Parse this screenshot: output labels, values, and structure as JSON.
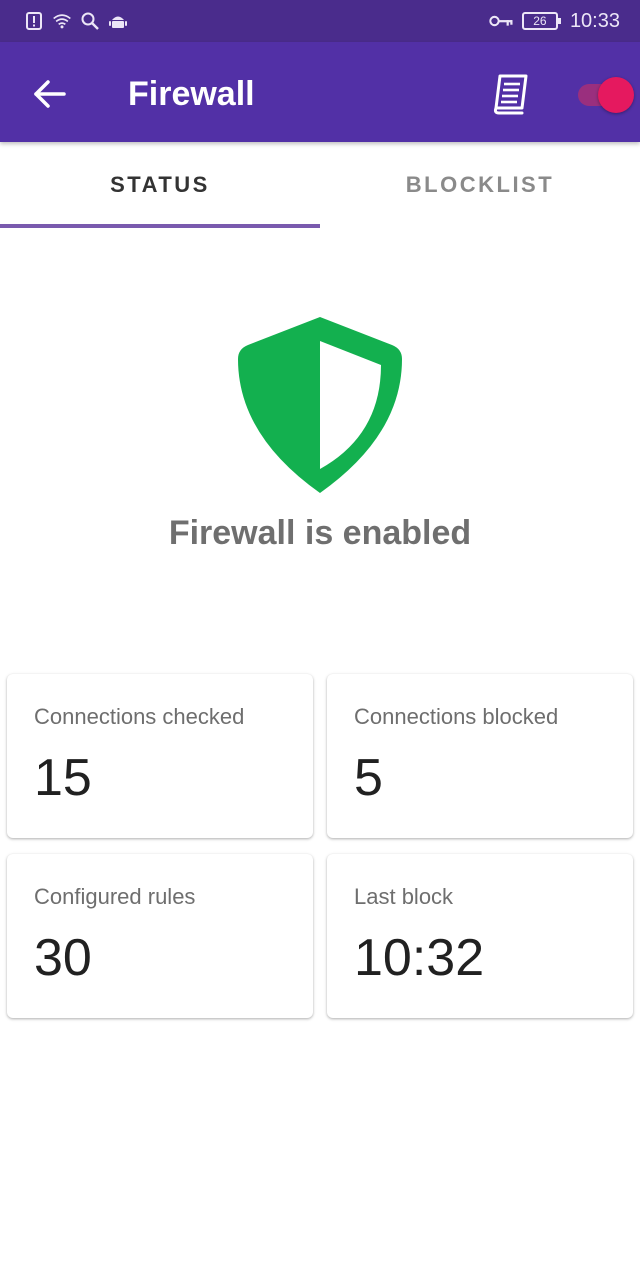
{
  "status_bar": {
    "time": "10:33",
    "battery": "26",
    "icons": [
      "alert-icon",
      "wifi-icon",
      "search-icon",
      "android-icon",
      "vpn-key-icon",
      "battery-icon"
    ]
  },
  "app_bar": {
    "title": "Firewall",
    "icons": [
      "back-arrow-icon",
      "book-icon"
    ],
    "toggle_on": true,
    "colors": {
      "bar": "#5230a6",
      "status_bar": "#4a2c8c",
      "switch_thumb": "#e5195f"
    }
  },
  "tabs": [
    {
      "label": "STATUS",
      "active": true
    },
    {
      "label": "BLOCKLIST",
      "active": false
    }
  ],
  "status": {
    "icon": "shield-icon",
    "icon_color": "#13b04f",
    "text": "Firewall is enabled"
  },
  "stats": [
    {
      "label": "Connections checked",
      "value": "15"
    },
    {
      "label": "Connections blocked",
      "value": "5"
    },
    {
      "label": "Configured rules",
      "value": "30"
    },
    {
      "label": "Last block",
      "value": "10:32"
    }
  ]
}
